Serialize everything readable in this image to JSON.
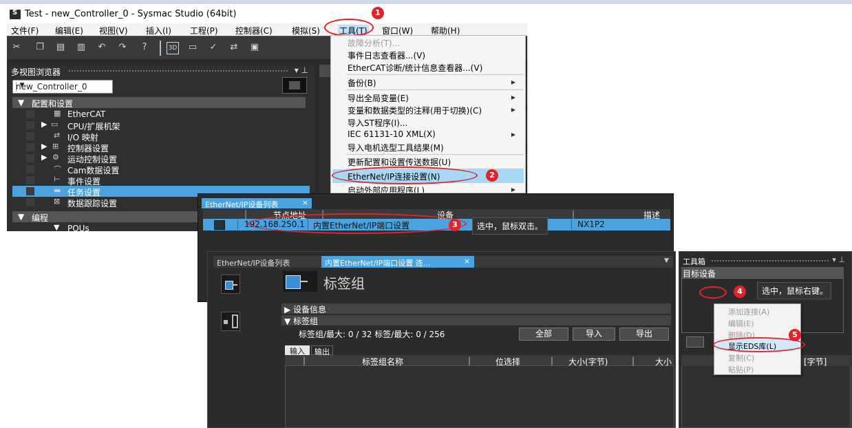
{
  "window": {
    "title": "Test - new_Controller_0 - Sysmac Studio (64bit)"
  },
  "menubar": [
    "文件(F)",
    "编辑(E)",
    "视图(V)",
    "插入(I)",
    "工程(P)",
    "控制器(C)",
    "模拟(S)",
    "工具(T)",
    "窗口(W)",
    "帮助(H)"
  ],
  "toolbar": {
    "preset_label": "3D"
  },
  "multiview": {
    "title": "多视图浏览器",
    "controller": "new_Controller_0",
    "section_config": "配置和设置",
    "items": [
      "EtherCAT",
      "CPU/扩展机架",
      "I/O 映射",
      "控制器设置",
      "运动控制设置",
      "Cam数据设置",
      "事件设置",
      "任务设置",
      "数据跟踪设置"
    ],
    "section_program": "编程",
    "pous": "POUs"
  },
  "tools_menu": [
    {
      "label": "故障分析(T)...",
      "disabled": true,
      "submenu": false
    },
    {
      "label": "事件日志查看器...(V)",
      "disabled": false,
      "submenu": false
    },
    {
      "label": "EtherCAT诊断/统计信息查看器...(V)",
      "disabled": false,
      "submenu": false
    },
    {
      "label": "备份(B)",
      "disabled": false,
      "submenu": true
    },
    {
      "label": "导出全局变量(E)",
      "disabled": false,
      "submenu": true
    },
    {
      "label": "变量和数据类型的注释(用于切换)(C)",
      "disabled": false,
      "submenu": true
    },
    {
      "label": "导入ST程序(I)...",
      "disabled": false,
      "submenu": false
    },
    {
      "label": "IEC 61131-10 XML(X)",
      "disabled": false,
      "submenu": true
    },
    {
      "label": "导入电机选型工具结果(M)",
      "disabled": false,
      "submenu": false
    },
    {
      "label": "更新配置和设置传送数据(U)",
      "disabled": false,
      "submenu": false
    },
    {
      "label": "EtherNet/IP连接设置(N)",
      "disabled": false,
      "submenu": false
    },
    {
      "label": "启动外部应用程序(L)",
      "disabled": false,
      "submenu": true
    }
  ],
  "device_list": {
    "tab": "EtherNet/IP设备列表",
    "headers": [
      "节点地址",
      "设备",
      "描述"
    ],
    "row": {
      "address": "192.168.250.1",
      "device": "内置EtherNet/IP端口设置",
      "model": "NX1P2"
    }
  },
  "editor": {
    "tab_inactive": "EtherNet/IP设备列表",
    "tab_active": "内置EtherNet/IP端口设置 连...",
    "title": "标签组",
    "sections": [
      "设备信息",
      "标签组"
    ],
    "count_text": "标签组/最大:  0  /  32      标签/最大:  0  /  256",
    "buttons": [
      "全部",
      "导入",
      "导出"
    ],
    "io_tabs": [
      "输入",
      "输出"
    ],
    "columns": [
      "标签组名称",
      "位选择",
      "大小(字节)",
      "大小"
    ]
  },
  "toolbox": {
    "title": "工具箱",
    "target": "目标设备",
    "context_menu": [
      {
        "label": "添加连接(A)",
        "enabled": false
      },
      {
        "label": "编辑(E)",
        "enabled": false
      },
      {
        "label": "删除(D)",
        "enabled": false
      },
      {
        "label": "显示EDS库(L)",
        "enabled": true
      },
      {
        "label": "复制(C)",
        "enabled": false
      },
      {
        "label": "粘贴(P)",
        "enabled": false
      }
    ],
    "grid_header": "[字节]"
  },
  "annotations": {
    "badges": [
      "1",
      "2",
      "3",
      "4",
      "5"
    ],
    "tip3": "选中，鼠标双击。",
    "tip4": "选中，鼠标右键。"
  },
  "colors": {
    "accent": "#4aa3df",
    "callout": "#e0252a",
    "dark": "#2b2b2b"
  }
}
